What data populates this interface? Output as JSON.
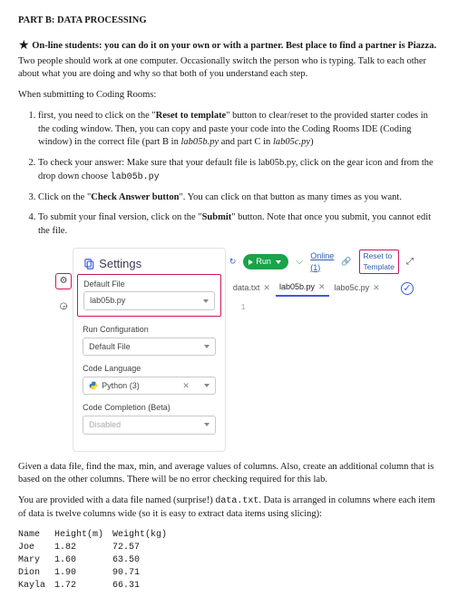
{
  "heading": "PART B: DATA PROCESSING",
  "intro_bold": "On-line students: you can do it on your own or with a partner. Best place to find a partner is Piazza.",
  "intro_rest": " Two people should work at one computer.  Occasionally switch the person who is typing.  Talk to each other about what you are doing and why so that both of you understand each step.",
  "submit_heading": "When submitting to Coding Rooms:",
  "steps": {
    "s1a": "first, you need to click on the \"",
    "s1b": "Reset to template",
    "s1c": "\" button to clear/reset to the provided starter codes in the coding window. Then, you can copy and paste your code into the Coding Rooms IDE (Coding window) in the correct file (part B in ",
    "s1d": "lab05b.py",
    "s1e": " and part C in ",
    "s1f": "lab05c.py",
    "s1g": ")",
    "s2a": "To check your answer: Make sure that your default file is lab05b.py, click on the gear icon and from the drop down choose ",
    "s2b": "lab05b.py",
    "s3a": "Click on the \"",
    "s3b": "Check Answer button",
    "s3c": "\". You can click on that button as many times as you want.",
    "s4a": "To submit your final version, click on the \"",
    "s4b": "Submit",
    "s4c": "\" button. Note that once you submit, you cannot edit the file."
  },
  "ide": {
    "title": "Settings",
    "default_file_label": "Default File",
    "default_file_value": "lab05b.py",
    "run_config_label": "Run Configuration",
    "run_config_value": "Default File",
    "lang_label": "Code Language",
    "lang_value": "Python (3)",
    "completion_label": "Code Completion (Beta)",
    "completion_value": "Disabled",
    "run": "Run",
    "online": "Online (1)",
    "reset": "Reset to Template",
    "tab1": "data.txt",
    "tab2": "lab05b.py",
    "tab3": "labo5c.py",
    "line1": "1"
  },
  "task_p1": "Given a data file, find the max, min, and average values of columns.  Also, create an additional column that is based on the other columns.  There will be no error checking required for this lab.",
  "task_p2a": "You are provided with a data file named (surprise!) ",
  "task_p2b": "data.txt",
  "task_p2c": ".  Data is arranged in columns where each item of data is twelve columns wide (so it is easy to extract data items using slicing):",
  "table": {
    "h1": "Name",
    "h2": "Height(m)",
    "h3": "Weight(kg)",
    "rows": [
      {
        "c1": "Joe",
        "c2": "1.82",
        "c3": "72.57"
      },
      {
        "c1": "Mary",
        "c2": "1.60",
        "c3": "63.50"
      },
      {
        "c1": "Dion",
        "c2": "1.90",
        "c3": "90.71"
      },
      {
        "c1": "Kayla",
        "c2": "1.72",
        "c3": "66.31"
      }
    ]
  }
}
